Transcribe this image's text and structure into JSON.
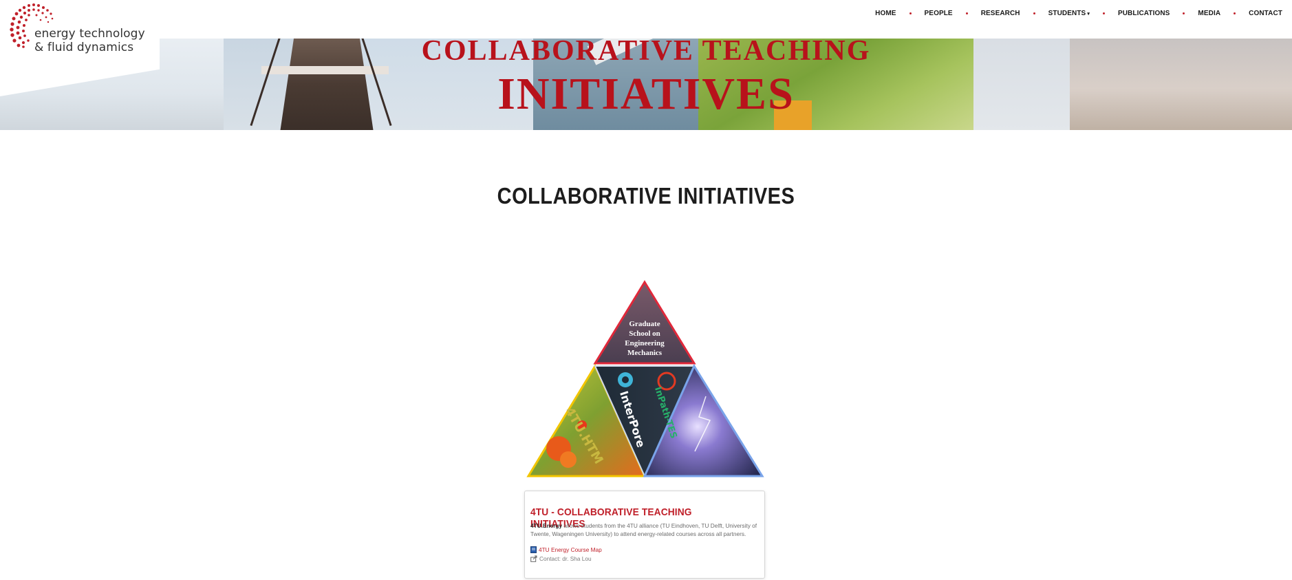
{
  "logo": {
    "line1": "energy technology",
    "line2": "& fluid dynamics"
  },
  "nav": {
    "items": [
      {
        "label": "HOME"
      },
      {
        "label": "PEOPLE"
      },
      {
        "label": "RESEARCH"
      },
      {
        "label": "STUDENTS"
      },
      {
        "label": "PUBLICATIONS"
      },
      {
        "label": "MEDIA"
      },
      {
        "label": "CONTACT"
      }
    ]
  },
  "hero": {
    "title_line1": "COLLABORATIVE TEACHING",
    "title_line2": "INITIATIVES"
  },
  "main": {
    "section_title": "COLLABORATIVE INITIATIVES",
    "triangle": {
      "top_label_lines": [
        "Graduate",
        "School on",
        "Engineering",
        "Mechanics"
      ],
      "left_label": "4TU.HTM",
      "middle_label_1": "InterPore",
      "middle_label_2": "InPath-TES"
    },
    "card": {
      "title": "4TU - COLLABORATIVE TEACHING INITIATIVES",
      "desc_bold": "4TU.Energy",
      "desc_rest": " allows students from the 4TU alliance (TU Eindhoven, TU Delft, University of Twente, Wageningen University) to attend energy-related courses across all partners.",
      "link_label": "4TU Energy Course Map",
      "contact": "Contact: dr. Sha Lou"
    }
  },
  "colors": {
    "accent": "#c0202a",
    "hero_text": "#b8121b"
  }
}
